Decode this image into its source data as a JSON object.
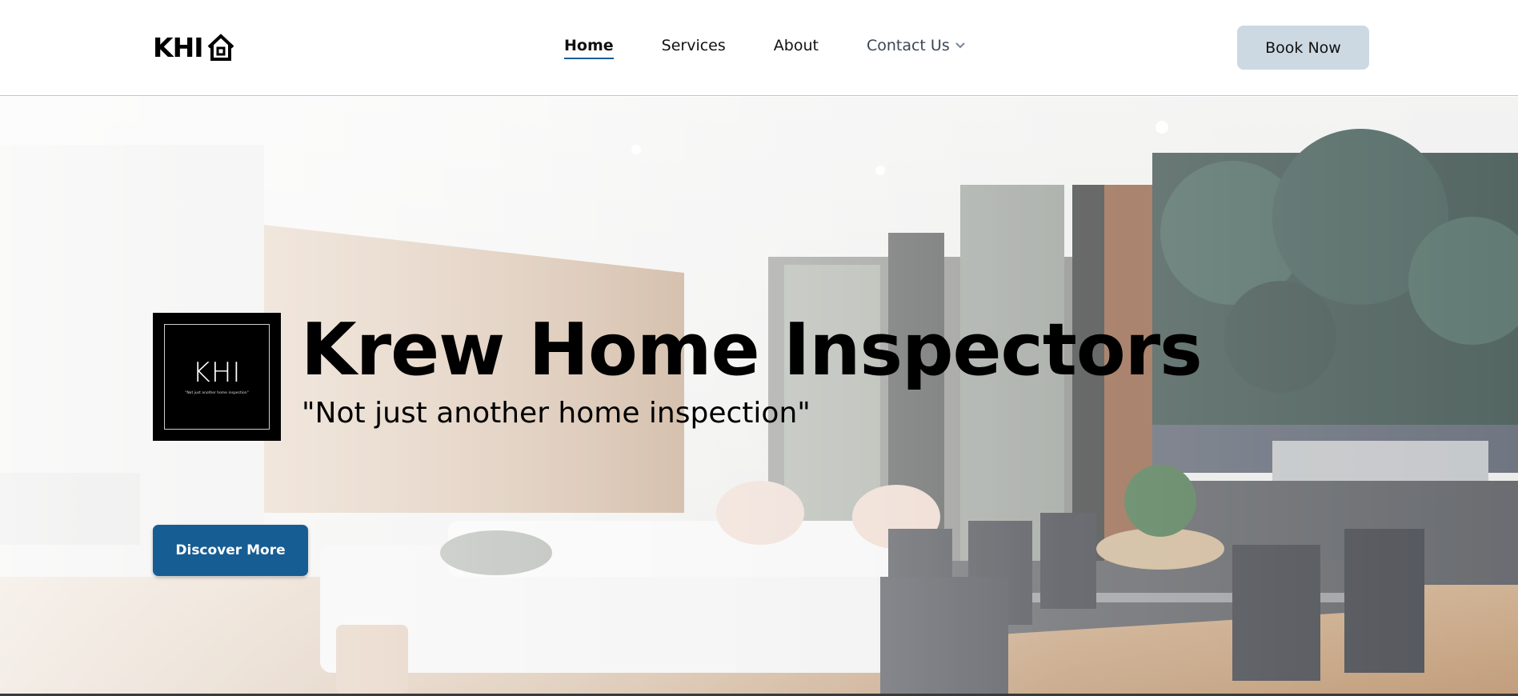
{
  "header": {
    "logo_text": "KHI",
    "logo_icon": "house-icon",
    "nav": [
      {
        "label": "Home",
        "active": true
      },
      {
        "label": "Services",
        "active": false
      },
      {
        "label": "About",
        "active": false
      },
      {
        "label": "Contact Us",
        "active": false,
        "icon": "chevron-down-icon"
      }
    ],
    "book_button": "Book Now"
  },
  "hero": {
    "logo_box_title": "KHI",
    "logo_box_tagline": "\"Not just another home inspection\"",
    "title": "Krew Home Inspectors",
    "subtitle": "\"Not just another home inspection\"",
    "cta": "Discover More"
  },
  "colors": {
    "accent": "#165d94",
    "book_button_bg": "#ccd9e2",
    "active_underline": "#1a5d96"
  }
}
